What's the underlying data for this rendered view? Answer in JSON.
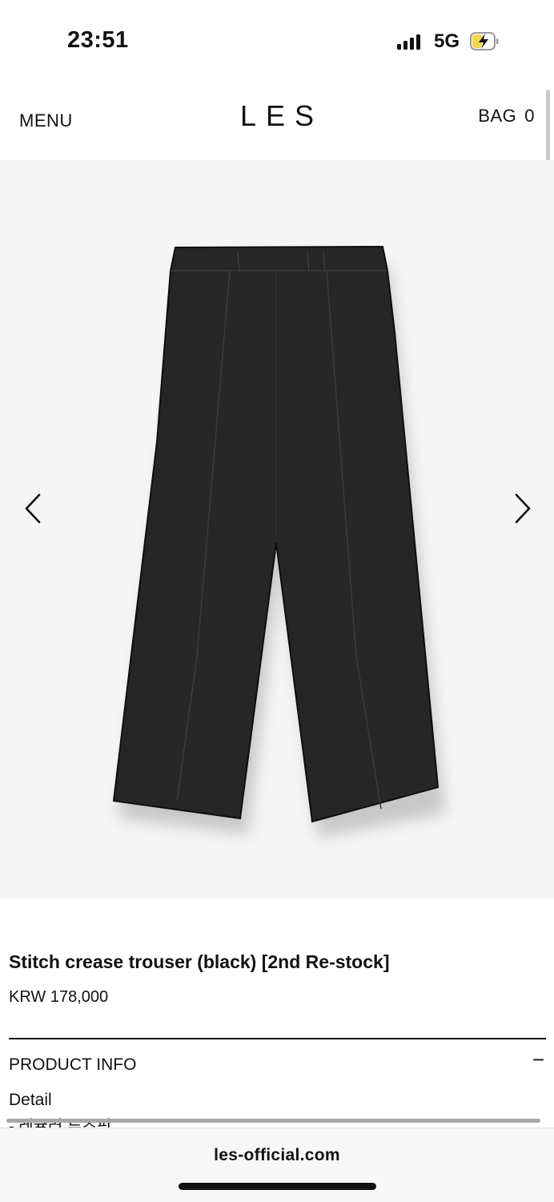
{
  "status": {
    "time": "23:51",
    "network": "5G"
  },
  "header": {
    "menu": "MENU",
    "logo": "LES",
    "bag": "BAG",
    "bag_count": "0"
  },
  "product": {
    "title": "Stitch crease trouser (black) [2nd Re-stock]",
    "price": "KRW 178,000",
    "info_heading": "PRODUCT INFO",
    "collapse_symbol": "−",
    "detail_title": "Detail",
    "detail_first_line": "- 레귤러 루즈핏"
  },
  "browser": {
    "url": "les-official.com"
  },
  "icons": {
    "prev": "chevron-left-icon",
    "next": "chevron-right-icon",
    "battery": "battery-charging-icon",
    "signal": "cellular-signal-icon"
  },
  "colors": {
    "battery_fill": "#f5d64a",
    "gallery_bg": "#f5f5f5",
    "garment": "#262626"
  }
}
